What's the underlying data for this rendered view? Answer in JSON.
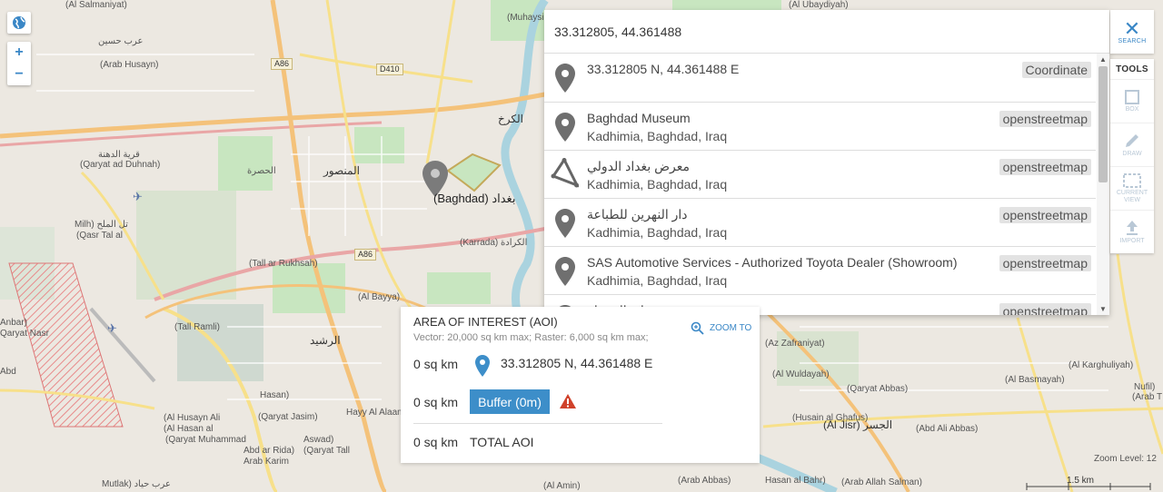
{
  "map": {
    "zoom_level_text": "Zoom Level: 12",
    "scale_text": "1.5 km",
    "labels": {
      "baghdad": "(Baghdad) بغداد",
      "karkh": "الكرخ",
      "mansour": "المنصور",
      "karrada": "(Karrada) الكرادة",
      "bayya": "(Al Bayya)",
      "rashid": "الرشيد",
      "husrah": "الحصرة",
      "arab_husayn": "(Arab Husayn)",
      "arab_husayn_ar": "عرب حسين",
      "duhnah_ar": "قرية الدهنة",
      "duhnah": "(Qaryat ad Duhnah)",
      "milh": "Milh) تل الملح",
      "qasr_tal": "(Qasr Tal al",
      "tall_rukhsah": "(Tall ar Rukhsah)",
      "tall_ramli": "(Tall Ramli)",
      "hayy_al_alaam": "Hayy Al Alaam",
      "qaryat_jasim": "(Qaryat Jasim)",
      "qaryat_muhammad": "(Qaryat Muhammad",
      "abd_ar_rida": "Abd ar Rida)",
      "arab_karim": "Arab Karim",
      "qaryat_tall": "(Qaryat Tall",
      "aswad": "Aswad)",
      "al_jisr": "(Al Jisr) الجسر",
      "az_zafraniyat": "(Az Zafraniyat)",
      "al_wuldayah": "(Al Wuldayah)",
      "qaryat_abbas": "(Qaryat Abbas)",
      "al_karghuliyah": "(Al Karghuliyah)",
      "abd_ali_abbas": "(Abd Ali Abbas)",
      "husain_al_ghafus": "(Husain al Ghafus)",
      "salmaniyat": "(Al Salmaniyat)",
      "muhaysin": "(Muhaysin)",
      "ubaydiyah": "(Al Ubaydiyah)",
      "arab_abbas": "(Arab Abbas)",
      "hasan_al_bahr": "Hasan al Bahr)",
      "arab_allah_salman": "(Arab Allah Salman)",
      "al_amin": "(Al Amin)",
      "mutlak": "Mutlak) عرب حياد",
      "qaryat_nasr": "Qaryat Nasr",
      "al_basmayah": "(Al Basmayah)",
      "nufil": "Nufil)",
      "arab_t": "(Arab T",
      "hasan_ar": "Hasan)",
      "ali_hasan": "(Al Hasan al",
      "al_husayn_ali": "(Al Husayn Ali",
      "abd": "Abd",
      "lbar": "Anbar)",
      "road_a86": "A86",
      "road_d410": "D410",
      "road_a86b": "A86"
    }
  },
  "controls": {
    "zoom_in": "+",
    "zoom_out": "−"
  },
  "search": {
    "value": "33.312805, 44.361488",
    "placeholder": "",
    "results": [
      {
        "title": "33.312805 N, 44.361488 E",
        "subtitle": "",
        "badge": "Coordinate",
        "icon": "map-pin-icon"
      },
      {
        "title": "Baghdad Museum",
        "subtitle": "Kadhimia, Baghdad, Iraq",
        "badge": "openstreetmap",
        "icon": "map-pin-icon"
      },
      {
        "title": "معرض بغداد الدولي",
        "subtitle": "Kadhimia, Baghdad, Iraq",
        "badge": "openstreetmap",
        "icon": "polygon-icon"
      },
      {
        "title": "دار النهرين للطباعة",
        "subtitle": "Kadhimia, Baghdad, Iraq",
        "badge": "openstreetmap",
        "icon": "map-pin-icon"
      },
      {
        "title": "SAS Automotive Services - Authorized Toyota Dealer (Showroom)",
        "subtitle": "Kadhimia, Baghdad, Iraq",
        "badge": "openstreetmap",
        "icon": "map-pin-icon"
      },
      {
        "title": "نقابة الصيدلة",
        "subtitle": "",
        "badge": "openstreetmap",
        "icon": "map-pin-icon"
      }
    ]
  },
  "toolbar": {
    "close_label": "SEARCH",
    "tools_title": "TOOLS",
    "tools": [
      {
        "label": "BOX",
        "icon": "box-icon"
      },
      {
        "label": "DRAW",
        "icon": "pencil-icon"
      },
      {
        "label": "CURRENT VIEW",
        "icon": "current-view-icon"
      },
      {
        "label": "IMPORT",
        "icon": "upload-icon"
      }
    ]
  },
  "aoi": {
    "title": "AREA OF INTEREST (AOI)",
    "limits": "Vector: 20,000 sq km max;  Raster: 6,000 sq km max;",
    "zoom_to": "ZOOM TO",
    "point_area": "0 sq km",
    "point_label": "33.312805 N, 44.361488 E",
    "buffer_area": "0 sq km",
    "buffer_button": "Buffer (0m)",
    "total_area": "0 sq km",
    "total_label": "TOTAL AOI"
  },
  "colors": {
    "accent": "#3a87c6",
    "button": "#3d8ec9",
    "warning": "#d0412a"
  }
}
